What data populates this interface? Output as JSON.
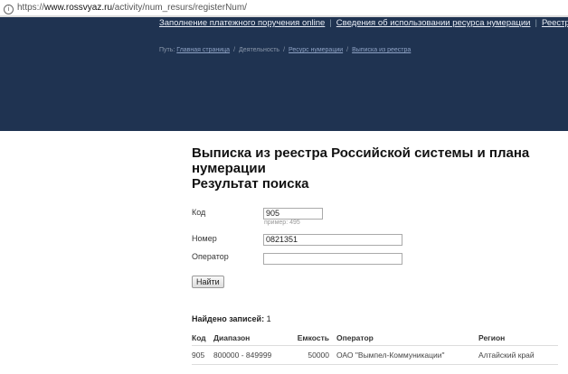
{
  "browser": {
    "url_prefix": "https://",
    "url_domain": "www.rossvyaz.ru",
    "url_path": "/activity/num_resurs/registerNum/"
  },
  "nav": [
    "Заполнение платежного поручения online",
    "Сведения об использовании ресурса нумерации",
    "Реестр кодов"
  ],
  "breadcrumb": {
    "label": "Путь:",
    "items": [
      "Главная страница",
      "Деятельность",
      "Ресурс нумерации",
      "Выписка из реестра"
    ]
  },
  "title": "Выписка из реестра Российской системы и плана нумерации",
  "subtitle": "Результат поиска",
  "form": {
    "code_label": "Код",
    "code_value": "905",
    "code_hint": "пример: 495",
    "number_label": "Номер",
    "number_value": "0821351",
    "operator_label": "Оператор",
    "operator_value": "",
    "submit": "Найти"
  },
  "results": {
    "found_label": "Найдено записей:",
    "found_count": "1",
    "headers": [
      "Код",
      "Диапазон",
      "Емкость",
      "Оператор",
      "Регион"
    ],
    "rows": [
      [
        "905",
        "800000 - 849999",
        "50000",
        "ОАО \"Вымпел-Коммуникации\"",
        "Алтайский край"
      ]
    ]
  }
}
